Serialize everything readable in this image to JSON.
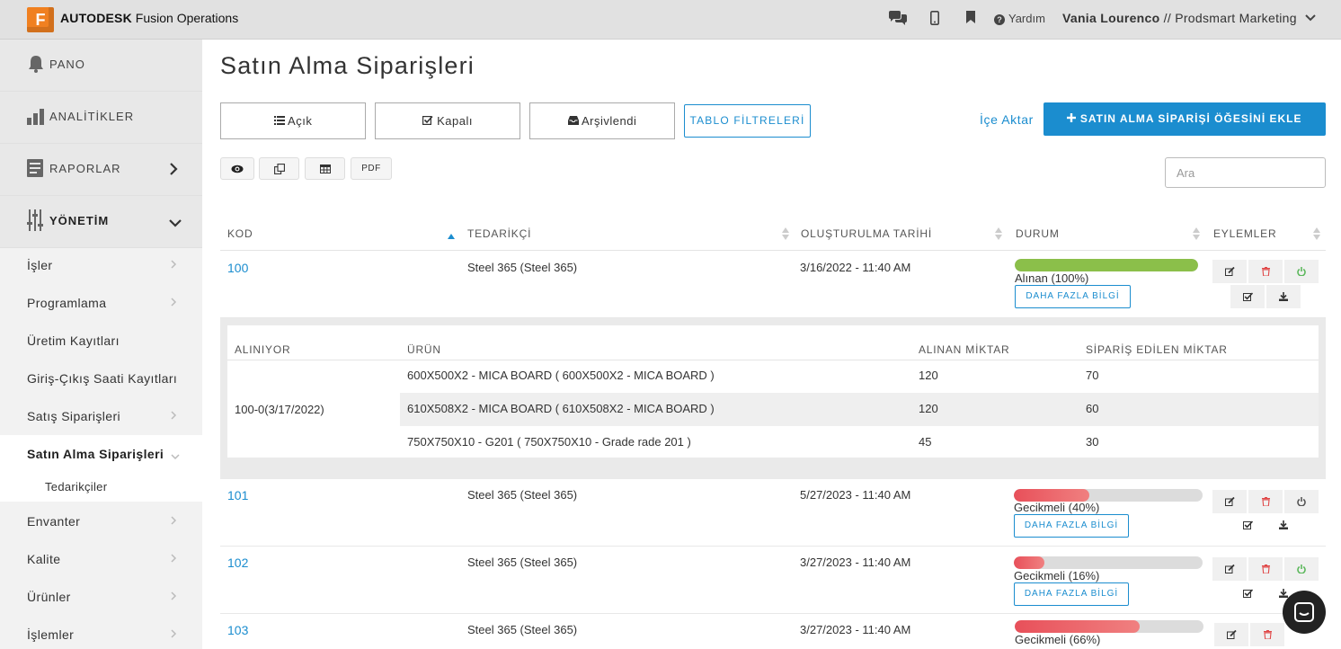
{
  "header": {
    "logo_letter": "F",
    "brand_bold": "AUTODESK",
    "brand_rest": " Fusion Operations",
    "help_label": "Yardım",
    "user_name": "Vania Lourenco",
    "user_org": " // Prodsmart Marketing",
    "icons": [
      "chat-icon",
      "mobile-icon",
      "bookmark-icon",
      "help-icon",
      "chevron-down-icon"
    ]
  },
  "sidebar": {
    "main_items": [
      {
        "label": "PANO",
        "icon": "bell-icon"
      },
      {
        "label": "ANALİTİKLER",
        "icon": "bar-chart-icon"
      },
      {
        "label": "RAPORLAR",
        "icon": "report-icon"
      },
      {
        "label": "YÖNETİM",
        "icon": "sliders-icon"
      }
    ],
    "sub_items": [
      {
        "label": "İşler"
      },
      {
        "label": "Programlama"
      },
      {
        "label": "Üretim Kayıtları"
      },
      {
        "label": "Giriş-Çıkış Saati Kayıtları"
      },
      {
        "label": "Satış Siparişleri"
      },
      {
        "label": "Satın Alma Siparişleri"
      },
      {
        "label": "Envanter"
      },
      {
        "label": "Kalite"
      },
      {
        "label": "Ürünler"
      },
      {
        "label": "İşlemler"
      }
    ],
    "child_item": "Tedarikçiler"
  },
  "page": {
    "title": "Satın Alma Siparişleri",
    "tabs": [
      {
        "label": "Açık",
        "icon": "list-icon"
      },
      {
        "label": "Kapalı",
        "icon": "check-square-icon"
      },
      {
        "label": "Arşivlendi",
        "icon": "inbox-icon"
      }
    ],
    "filter_button": "TABLO FİLTRELERİ",
    "import_link": "İçe Aktar",
    "add_button": "SATIN ALMA SİPARİŞİ ÖĞESİNİ EKLE",
    "tool_buttons": [
      "eye-icon",
      "copy-icon",
      "table-icon"
    ],
    "pdf_label": "PDF",
    "search_placeholder": "Ara"
  },
  "table": {
    "headers": [
      "KOD",
      "TEDARİKÇİ",
      "OLUŞTURULMA TARİHİ",
      "DURUM",
      "EYLEMLER"
    ],
    "info_button": "DAHA FAZLA BİLGİ",
    "rows": [
      {
        "code": "100",
        "supplier": "Steel 365 (Steel 365)",
        "date": "3/16/2022 - 11:40 AM",
        "status": "Alınan (100%)",
        "progress": 1.0,
        "color": "#8bbf4a"
      },
      {
        "code": "101",
        "supplier": "Steel 365 (Steel 365)",
        "date": "5/27/2023 - 11:40 AM",
        "status": "Gecikmeli (40%)",
        "progress": 0.4,
        "color": "#e8505a"
      },
      {
        "code": "102",
        "supplier": "Steel 365 (Steel 365)",
        "date": "3/27/2023 - 11:40 AM",
        "status": "Gecikmeli (16%)",
        "progress": 0.16,
        "color": "#e8505a"
      },
      {
        "code": "103",
        "supplier": "Steel 365 (Steel 365)",
        "date": "3/27/2023 - 11:40 AM",
        "status": "Gecikmeli (66%)",
        "progress": 0.66,
        "color": "#e8505a"
      }
    ]
  },
  "detail": {
    "headers": [
      "ALINIYOR",
      "ÜRÜN",
      "ALINAN MİKTAR",
      "SİPARİŞ EDİLEN MİKTAR"
    ],
    "receiving": "100-0(3/17/2022)",
    "items": [
      {
        "product": "600X500X2 - MICA BOARD ( 600X500X2 - MICA BOARD )",
        "received": "120",
        "ordered": "70"
      },
      {
        "product": "610X508X2 - MICA BOARD ( 610X508X2 - MICA BOARD )",
        "received": "120",
        "ordered": "60"
      },
      {
        "product": "750X750X10 - G201 ( 750X750X10 - Grade rade 201 )",
        "received": "45",
        "ordered": "30"
      }
    ]
  }
}
